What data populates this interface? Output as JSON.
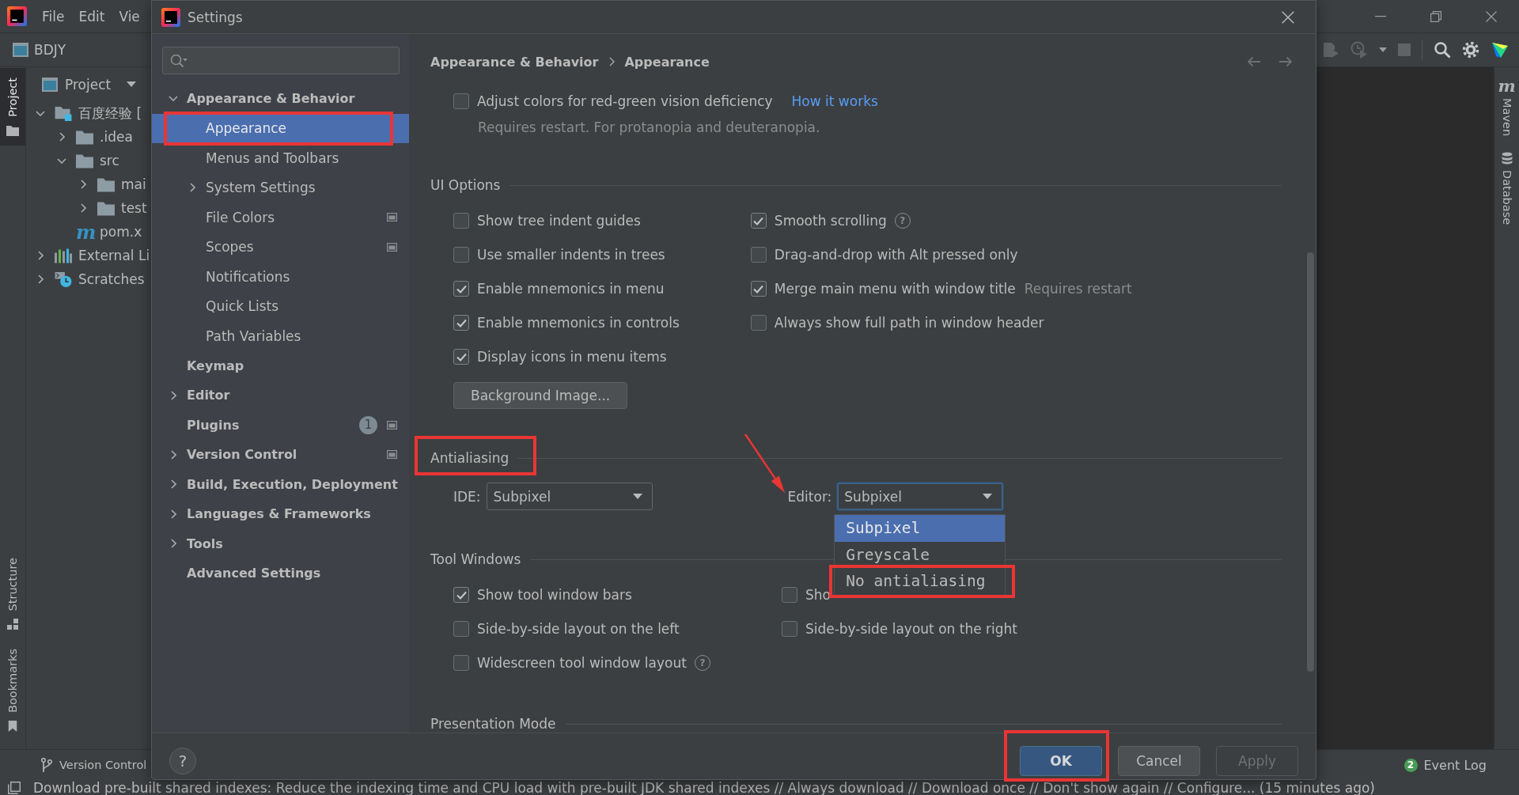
{
  "ide": {
    "menu": [
      "File",
      "Edit",
      "Vie"
    ],
    "project_name": "BDJY",
    "left_tool_tabs": {
      "top": [
        {
          "label": "Project",
          "kind": "project",
          "selected": true
        }
      ],
      "bottom": [
        {
          "label": "Structure",
          "kind": "structure",
          "selected": false
        },
        {
          "label": "Bookmarks",
          "kind": "bookmarks",
          "selected": false
        }
      ]
    },
    "project_panel": {
      "title": "Project",
      "tree": [
        {
          "label": "百度经验 [",
          "kind": "module",
          "selected": false,
          "expanded": true,
          "children": [
            {
              "label": ".idea",
              "kind": "folder",
              "selected": false,
              "expanded": false
            },
            {
              "label": "src",
              "kind": "folder",
              "selected": false,
              "expanded": true,
              "children": [
                {
                  "label": "mai",
                  "kind": "folder",
                  "selected": false,
                  "expanded": false
                },
                {
                  "label": "test",
                  "kind": "folder",
                  "selected": false,
                  "expanded": false
                }
              ]
            },
            {
              "label": "pom.x",
              "kind": "maven",
              "icon": "m",
              "selected": false
            }
          ]
        },
        {
          "label": "External Li",
          "kind": "libraries",
          "selected": false,
          "expanded": false
        },
        {
          "label": "Scratches",
          "kind": "scratches",
          "selected": false,
          "expanded": false
        }
      ]
    },
    "right_tool_tabs": [
      {
        "label": "Maven",
        "kind": "maven",
        "icon": "m",
        "selected": false
      },
      {
        "label": "Database",
        "kind": "database",
        "selected": false
      }
    ],
    "bottom_tabs": [
      {
        "label": "Version Control",
        "kind": "vcs",
        "selected": false
      }
    ],
    "event_log": {
      "count": "2",
      "label": "Event Log"
    },
    "status_message": "Download pre-built shared indexes: Reduce the indexing time and CPU load with pre-built JDK shared indexes // Always download // Download once // Don't show again // Configure... (15 minutes ago)"
  },
  "dialog": {
    "title": "Settings",
    "sidebar": [
      {
        "label": "Appearance & Behavior",
        "selected": false,
        "expanded": true,
        "children": [
          {
            "label": "Appearance",
            "selected": true,
            "highlighted": true
          },
          {
            "label": "Menus and Toolbars",
            "selected": false
          },
          {
            "label": "System Settings",
            "selected": false,
            "expanded": false
          },
          {
            "label": "File Colors",
            "selected": false,
            "project_level": true
          },
          {
            "label": "Scopes",
            "selected": false,
            "project_level": true
          },
          {
            "label": "Notifications",
            "selected": false
          },
          {
            "label": "Quick Lists",
            "selected": false
          },
          {
            "label": "Path Variables",
            "selected": false
          }
        ]
      },
      {
        "label": "Keymap",
        "selected": false
      },
      {
        "label": "Editor",
        "selected": false,
        "expanded": false
      },
      {
        "label": "Plugins",
        "selected": false,
        "badge": "1",
        "project_level": true
      },
      {
        "label": "Version Control",
        "selected": false,
        "expanded": false,
        "project_level": true
      },
      {
        "label": "Build, Execution, Deployment",
        "selected": false,
        "expanded": false
      },
      {
        "label": "Languages & Frameworks",
        "selected": false,
        "expanded": false
      },
      {
        "label": "Tools",
        "selected": false,
        "expanded": false
      },
      {
        "label": "Advanced Settings",
        "selected": false
      }
    ],
    "breadcrumb": [
      "Appearance & Behavior",
      "Appearance"
    ],
    "top_option": {
      "label": "Adjust colors for red-green vision deficiency",
      "checked": false,
      "link": "How it works",
      "hint": "Requires restart. For protanopia and deuteranopia."
    },
    "sections": [
      {
        "title": "UI Options",
        "options": [
          {
            "label": "Show tree indent guides",
            "checked": false
          },
          {
            "label": "Smooth scrolling",
            "checked": true,
            "help": "?"
          },
          {
            "label": "Use smaller indents in trees",
            "checked": false
          },
          {
            "label": "Drag-and-drop with Alt pressed only",
            "checked": false
          },
          {
            "label": "Enable mnemonics in menu",
            "checked": true
          },
          {
            "label": "Merge main menu with window title",
            "checked": true,
            "hint": "Requires restart"
          },
          {
            "label": "Enable mnemonics in controls",
            "checked": true
          },
          {
            "label": "Always show full path in window header",
            "checked": false
          },
          {
            "label": "Display icons in menu items",
            "checked": true
          }
        ],
        "button": "Background Image..."
      },
      {
        "title": "Antialiasing",
        "highlighted": true,
        "combos": [
          {
            "label": "IDE:",
            "value": "Subpixel",
            "focused": false
          },
          {
            "label": "Editor:",
            "value": "Subpixel",
            "focused": true,
            "arrow": true,
            "options": [
              {
                "label": "Subpixel",
                "selected": true
              },
              {
                "label": "Greyscale",
                "selected": false
              },
              {
                "label": "No antialiasing",
                "selected": false,
                "highlighted": true
              }
            ]
          }
        ]
      },
      {
        "title": "Tool Windows",
        "options": [
          {
            "label": "Show tool window bars",
            "checked": true
          },
          {
            "label": "Sho",
            "checked": false
          },
          {
            "label": "Side-by-side layout on the left",
            "checked": false
          },
          {
            "label": "Side-by-side layout on the right",
            "checked": false
          },
          {
            "label": "Widescreen tool window layout",
            "checked": false,
            "help": "?"
          }
        ]
      },
      {
        "title": "Presentation Mode"
      }
    ],
    "help_button": "?",
    "buttons": [
      {
        "label": "OK",
        "default": true,
        "highlighted": true
      },
      {
        "label": "Cancel"
      },
      {
        "label": "Apply",
        "disabled": true
      }
    ]
  }
}
